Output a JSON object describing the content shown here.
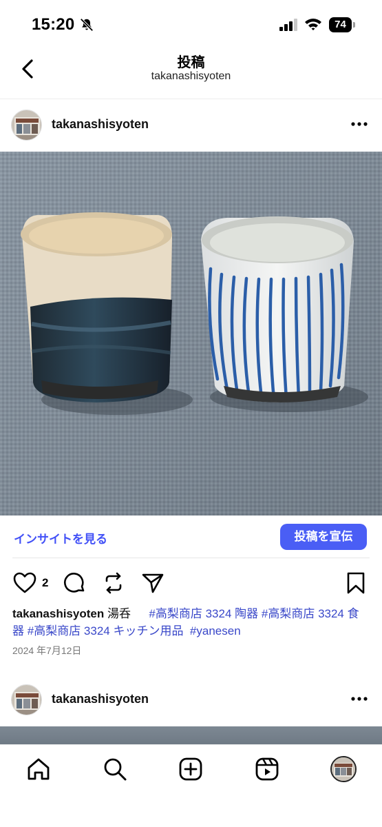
{
  "status_bar": {
    "time": "15:20",
    "battery": "74"
  },
  "header": {
    "title": "投稿",
    "subtitle": "takanashisyoten"
  },
  "post": {
    "username": "takanashisyoten",
    "insights_label": "インサイトを見る",
    "promote_label": "投稿を宣伝",
    "like_count": "2",
    "caption_user": "takanashisyoten",
    "caption_text": "湯呑　",
    "hashtags": [
      "#高梨商店 3324 陶器",
      "#高梨商店 3324 食器",
      "#高梨商店 3324 キッチン用品",
      "#yanesen"
    ],
    "date": "2024 年7月12日"
  },
  "next_post": {
    "username": "takanashisyoten"
  },
  "icons": {
    "status": [
      "bell-slash-icon",
      "signal-icon",
      "wifi-icon",
      "battery-icon"
    ],
    "header": [
      "chevron-left-icon"
    ],
    "actions": [
      "heart-icon",
      "comment-icon",
      "repost-icon",
      "send-icon",
      "bookmark-icon"
    ],
    "tabs": [
      "home-icon",
      "search-icon",
      "create-icon",
      "reels-icon",
      "profile-avatar"
    ]
  },
  "colors": {
    "accent": "#4a5ef5",
    "link": "#4150f7",
    "hashtag": "#3a48c9"
  }
}
